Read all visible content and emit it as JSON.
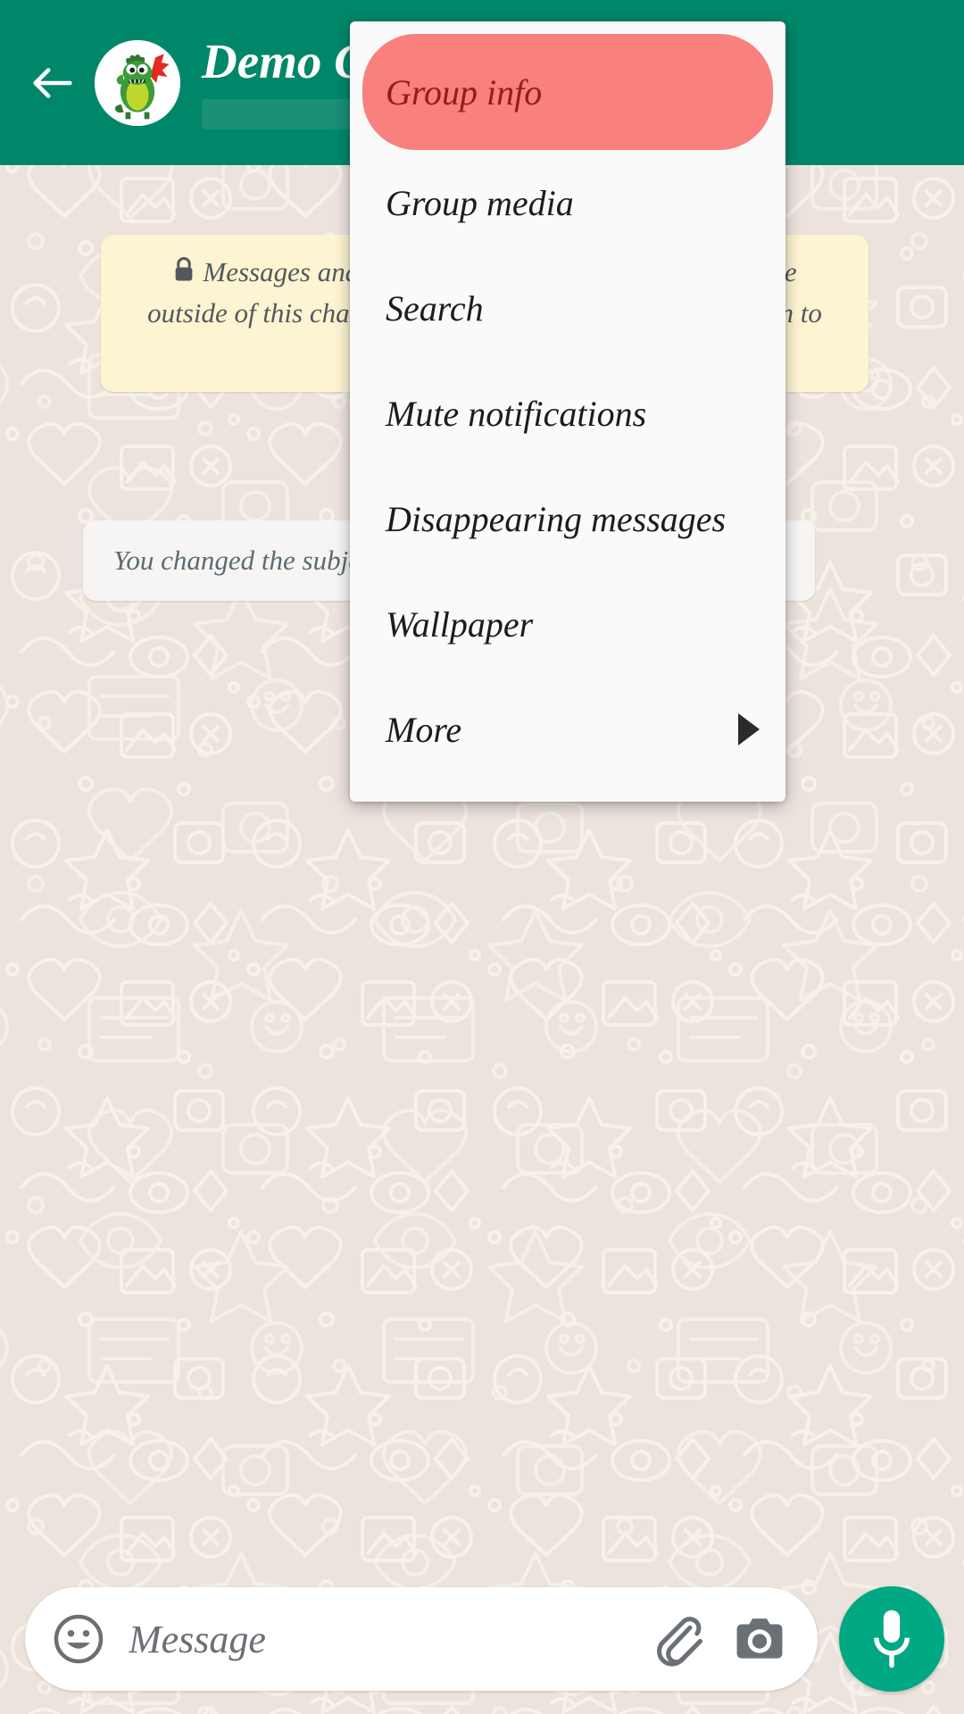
{
  "app": {
    "name": "WhatsApp",
    "colors": {
      "header_green": "#00876a",
      "accent_green": "#00a884",
      "wallpaper": "#ece4dc",
      "encryption_bubble": "#fdf4d2",
      "system_bubble": "#f6f5f3",
      "menu_surface": "#fafafa",
      "selected_item_bg": "#f9807c",
      "selected_item_text": "#8e1f1c"
    }
  },
  "header": {
    "back_icon": "arrow-left-icon",
    "avatar_icon": "group-avatar-dinosaur",
    "title": "Demo Group",
    "subtitle": ""
  },
  "chat": {
    "date_chip": "",
    "encryption_notice": {
      "icon": "lock-icon",
      "text": "Messages and calls are end-to-end encrypted. No one outside of this chat, not even WhatsApp, can read or listen to them. Tap to learn more."
    },
    "system_message": {
      "text": "You changed the subject to “Demo Group”"
    }
  },
  "menu": {
    "items": [
      {
        "label": "Group info",
        "selected": true,
        "has_submenu": false
      },
      {
        "label": "Group media",
        "selected": false,
        "has_submenu": false
      },
      {
        "label": "Search",
        "selected": false,
        "has_submenu": false
      },
      {
        "label": "Mute notifications",
        "selected": false,
        "has_submenu": false
      },
      {
        "label": "Disappearing messages",
        "selected": false,
        "has_submenu": false
      },
      {
        "label": "Wallpaper",
        "selected": false,
        "has_submenu": false
      },
      {
        "label": "More",
        "selected": false,
        "has_submenu": true
      }
    ],
    "submenu_arrow_icon": "triangle-right-icon"
  },
  "composer": {
    "emoji_icon": "emoji-smiley-icon",
    "placeholder": "Message",
    "attach_icon": "paperclip-icon",
    "camera_icon": "camera-icon",
    "mic_icon": "microphone-icon"
  }
}
